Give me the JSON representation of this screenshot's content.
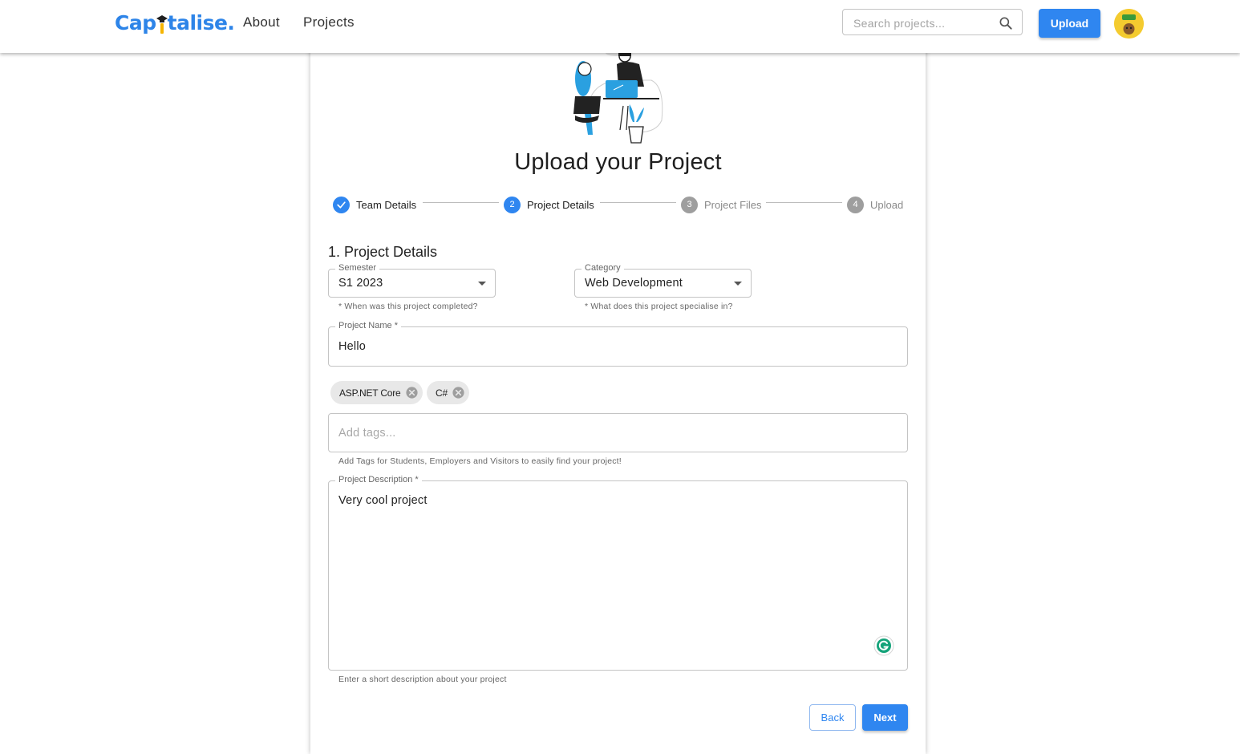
{
  "header": {
    "logo_left": "Cap",
    "logo_right": "talise.",
    "nav": [
      {
        "label": "About"
      },
      {
        "label": "Projects"
      }
    ],
    "search": {
      "placeholder": "Search projects..."
    },
    "upload_label": "Upload"
  },
  "page": {
    "title": "Upload your Project",
    "steps": [
      {
        "number": "1",
        "label": "Team Details",
        "state": "completed"
      },
      {
        "number": "2",
        "label": "Project Details",
        "state": "active"
      },
      {
        "number": "3",
        "label": "Project Files",
        "state": "pending"
      },
      {
        "number": "4",
        "label": "Upload",
        "state": "pending"
      }
    ],
    "section_title": "1. Project Details"
  },
  "form": {
    "semester": {
      "label": "Semester",
      "value": "S1 2023",
      "helper": "* When was this project completed?"
    },
    "category": {
      "label": "Category",
      "value": "Web Development",
      "helper": "* What does this project specialise in?"
    },
    "project_name": {
      "label": "Project Name *",
      "value": "Hello"
    },
    "tags": [
      {
        "label": "ASP.NET Core"
      },
      {
        "label": "C#"
      }
    ],
    "tag_input": {
      "placeholder": "Add tags...",
      "helper": "Add Tags for Students, Employers and Visitors to easily find your project!"
    },
    "description": {
      "label": "Project Description *",
      "value": "Very cool project",
      "helper": "Enter a short description about your project"
    },
    "back_label": "Back",
    "next_label": "Next"
  },
  "colors": {
    "primary": "#2f86f0",
    "logo_accent": "#f5b400",
    "pending_step": "#9e9e9e"
  },
  "icons": [
    "search-icon",
    "check-icon",
    "chevron-down-icon",
    "cancel-icon",
    "grammarly-icon"
  ]
}
